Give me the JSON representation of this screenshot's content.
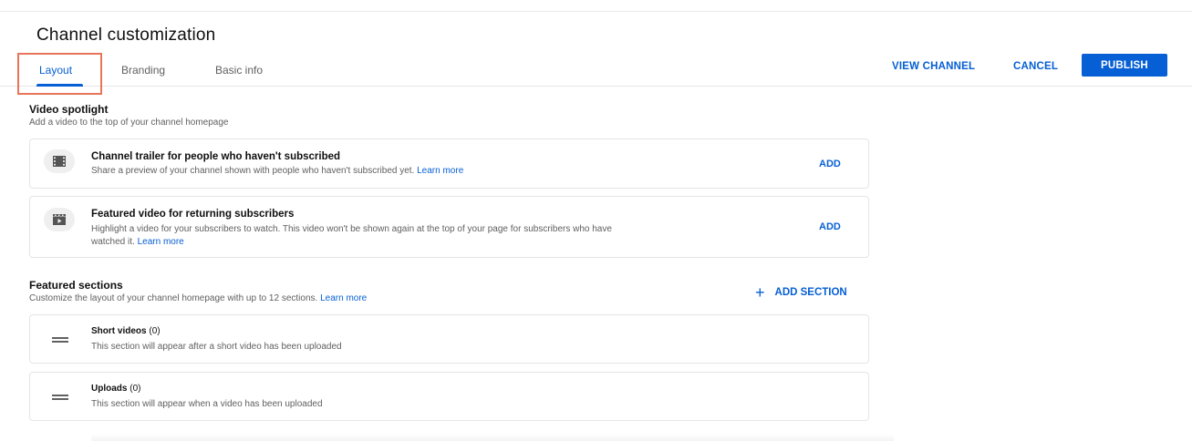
{
  "page": {
    "title": "Channel customization"
  },
  "tabs": [
    {
      "label": "Layout",
      "active": true
    },
    {
      "label": "Branding",
      "active": false
    },
    {
      "label": "Basic info",
      "active": false
    }
  ],
  "header_actions": {
    "view_channel": "VIEW CHANNEL",
    "cancel": "CANCEL",
    "publish": "PUBLISH"
  },
  "video_spotlight": {
    "title": "Video spotlight",
    "subtitle": "Add a video to the top of your channel homepage",
    "cards": [
      {
        "icon": "film-icon",
        "title": "Channel trailer for people who haven't subscribed",
        "description": "Share a preview of your channel shown with people who haven't subscribed yet.",
        "link": "Learn more",
        "action": "ADD"
      },
      {
        "icon": "clapperboard-icon",
        "title": "Featured video for returning subscribers",
        "description_line1": "Highlight a video for your subscribers to watch. This video won't be shown again at the top of your page for subscribers who have",
        "description_line2": "watched it.",
        "link": "Learn more",
        "action": "ADD"
      }
    ]
  },
  "featured_sections": {
    "title": "Featured sections",
    "subtitle": "Customize the layout of your channel homepage with up to 12 sections.",
    "link": "Learn more",
    "add_section": "ADD SECTION",
    "items": [
      {
        "name": "Short videos",
        "count": "(0)",
        "description": "This section will appear after a short video has been uploaded"
      },
      {
        "name": "Uploads",
        "count": "(0)",
        "description": "This section will appear when a video has been uploaded"
      }
    ]
  },
  "colors": {
    "accent": "#065fd4",
    "highlight_border": "#e8745a",
    "text_secondary": "#606060"
  }
}
